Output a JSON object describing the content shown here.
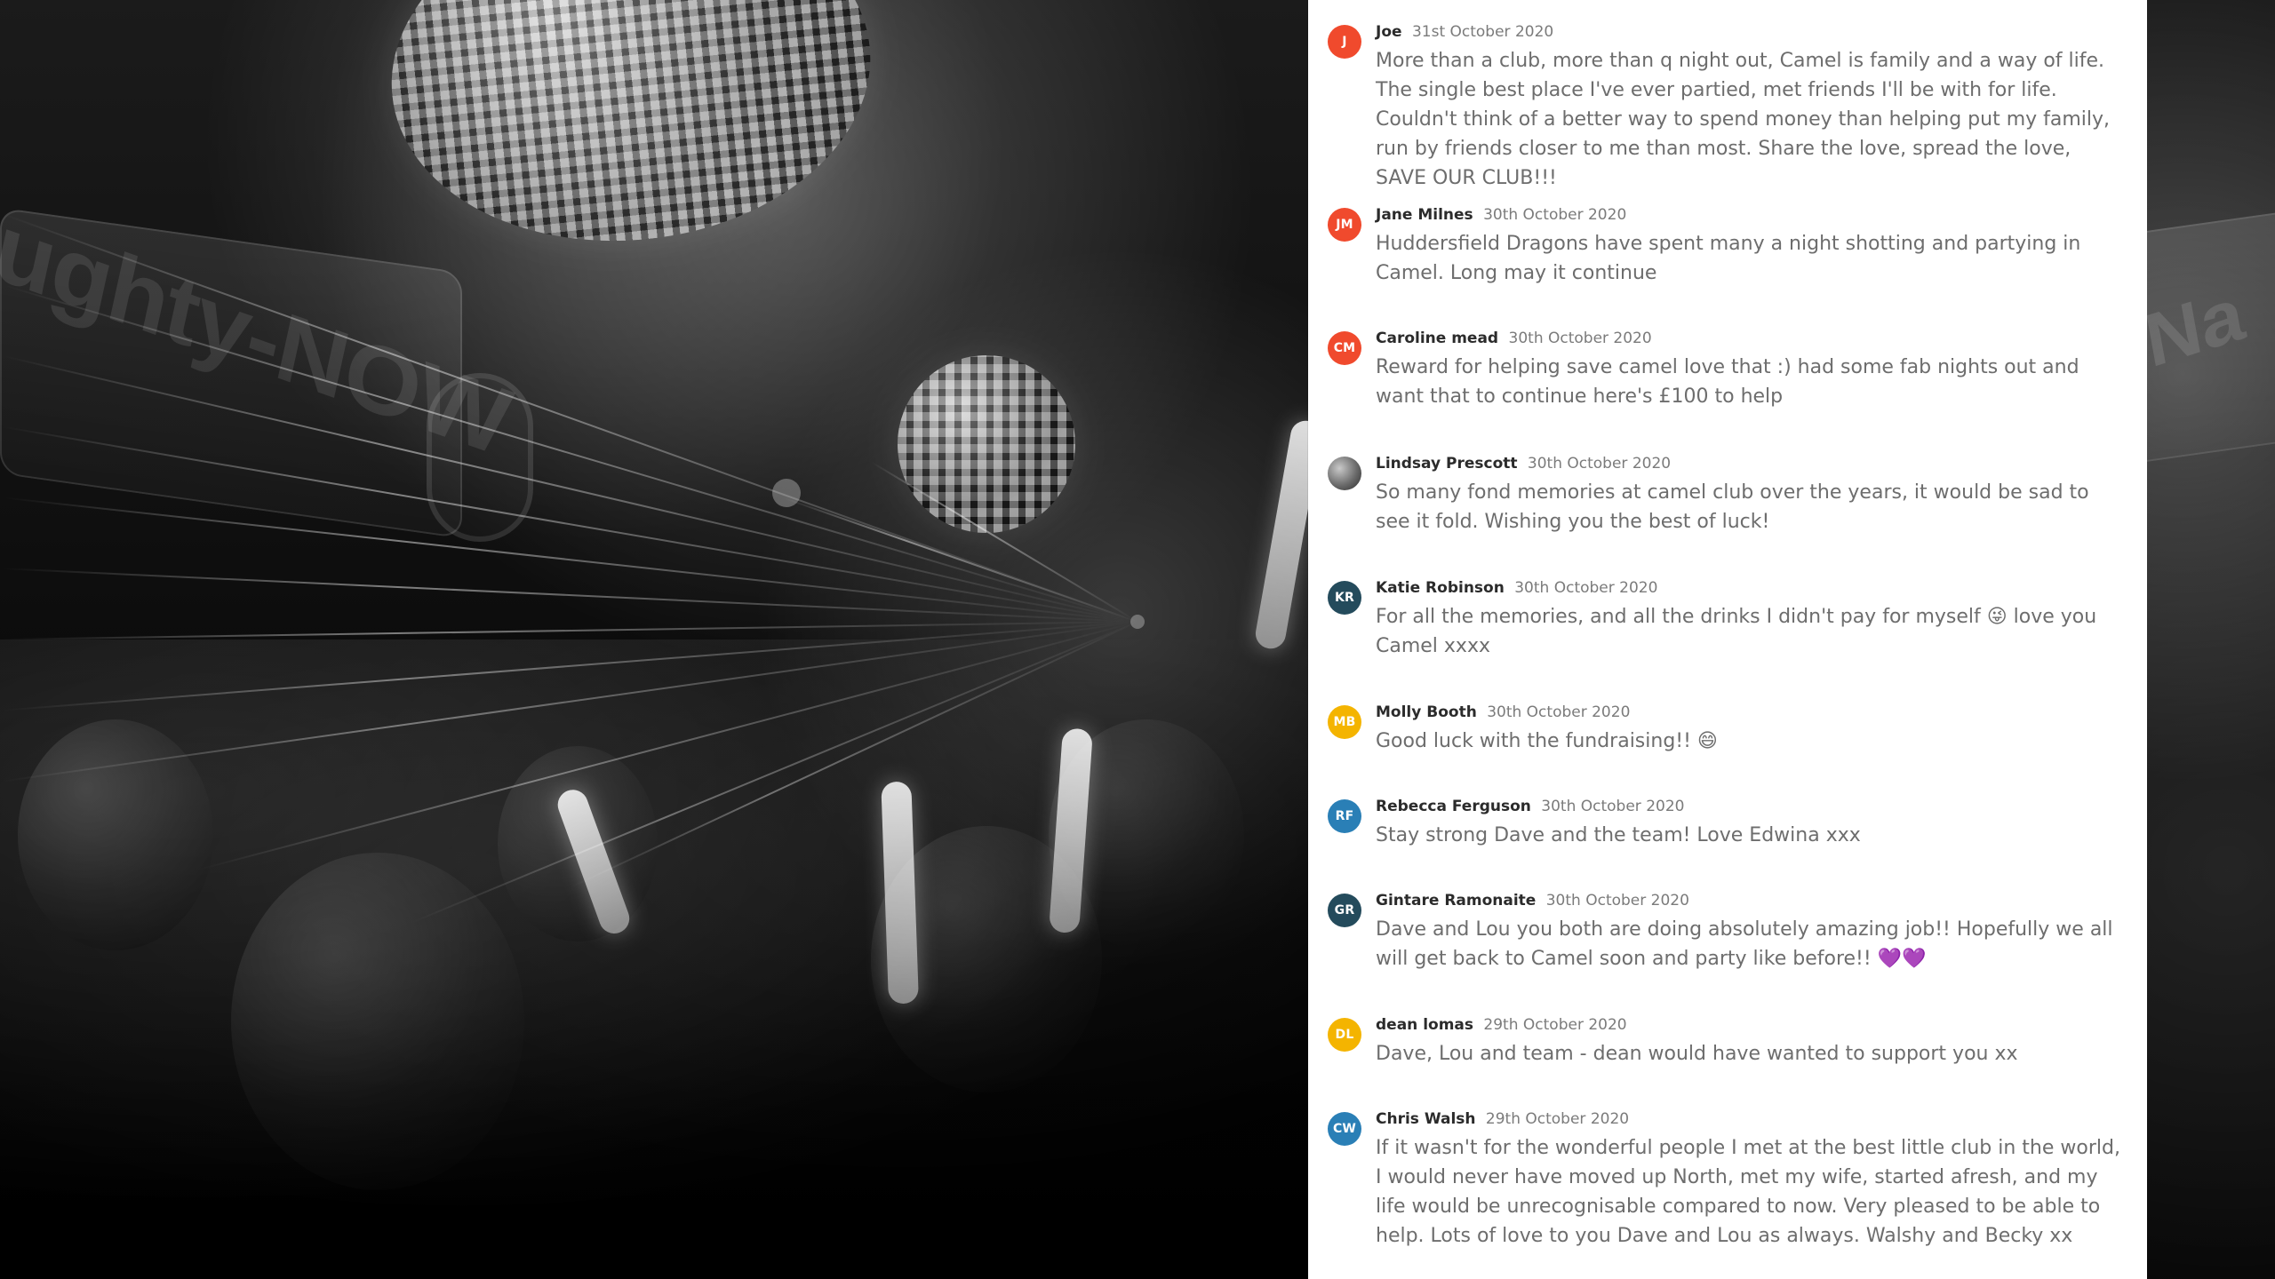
{
  "left_photo": {
    "sign_text": "ughty-NOW"
  },
  "right_photo": {
    "sign_text": "-Na"
  },
  "comments": [
    {
      "avatar": {
        "initials": "J",
        "color": "#F04A2D",
        "type": "initials"
      },
      "author": "Joe",
      "date": "31st October 2020",
      "text": "More than a club, more than q night out, Camel is family and a way of life. The single best place I've ever partied, met friends I'll be with for life. Couldn't think of a better way to spend money than helping put my family, run by friends closer to me than most. Share the love, spread the love, SAVE OUR CLUB!!!"
    },
    {
      "avatar": {
        "initials": "JM",
        "color": "#F04A2D",
        "type": "initials"
      },
      "author": "Jane Milnes",
      "date": "30th October 2020",
      "text": "Huddersfield Dragons have spent many a night shotting and partying in Camel. Long may it continue"
    },
    {
      "avatar": {
        "initials": "CM",
        "color": "#F04A2D",
        "type": "initials"
      },
      "author": "Caroline mead",
      "date": "30th October 2020",
      "text": "Reward for helping save camel love that :) had some fab nights out and want that to continue here's £100 to help"
    },
    {
      "avatar": {
        "initials": "",
        "color": "#666666",
        "type": "photo"
      },
      "author": "Lindsay Prescott",
      "date": "30th October 2020",
      "text": "So many fond memories at camel club over the years, it would be sad to see it fold. Wishing you the best of luck!"
    },
    {
      "avatar": {
        "initials": "KR",
        "color": "#244B5C",
        "type": "initials"
      },
      "author": "Katie Robinson",
      "date": "30th October 2020",
      "text": "For all the memories, and all the drinks I didn't pay for myself 😜 love you Camel xxxx"
    },
    {
      "avatar": {
        "initials": "MB",
        "color": "#F4B400",
        "type": "initials"
      },
      "author": "Molly Booth",
      "date": "30th October 2020",
      "text": "Good luck with the fundraising!! 😄"
    },
    {
      "avatar": {
        "initials": "RF",
        "color": "#2A7FB6",
        "type": "initials"
      },
      "author": "Rebecca Ferguson",
      "date": "30th October 2020",
      "text": "Stay strong Dave and the team! Love Edwina xxx"
    },
    {
      "avatar": {
        "initials": "GR",
        "color": "#244B5C",
        "type": "initials"
      },
      "author": "Gintare Ramonaite",
      "date": "30th October 2020",
      "text": "Dave and Lou you both are doing absolutely amazing job!! Hopefully we all will get back to Camel soon and party like before!! 💜💜"
    },
    {
      "avatar": {
        "initials": "DL",
        "color": "#F4B400",
        "type": "initials"
      },
      "author": "dean lomas",
      "date": "29th October 2020",
      "text": "Dave, Lou and team - dean would have wanted to support you xx"
    },
    {
      "avatar": {
        "initials": "CW",
        "color": "#2A7FB6",
        "type": "initials"
      },
      "author": "Chris Walsh",
      "date": "29th October 2020",
      "text": "If it wasn't for the wonderful people I met at the best little club in the world, I would never have moved up North, met my wife, started afresh, and my life would be unrecognisable compared to now. Very pleased to be able to help. Lots of love to you Dave and Lou as always. Walshy and Becky xx"
    }
  ]
}
